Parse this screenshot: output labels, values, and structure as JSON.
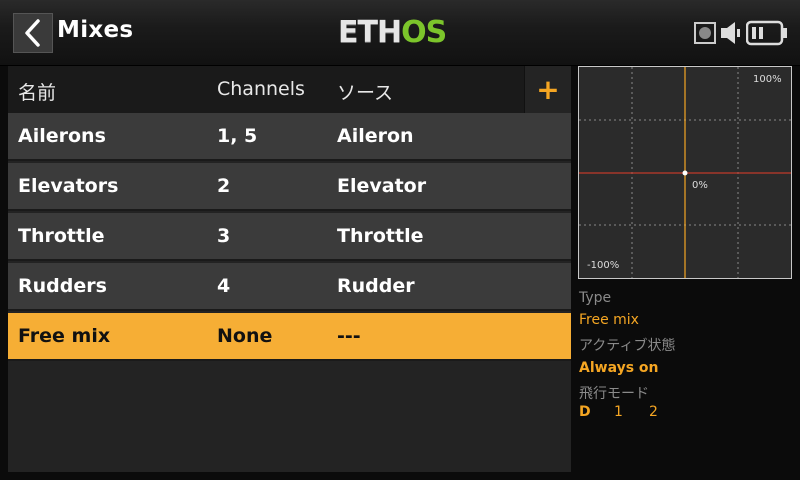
{
  "header": {
    "title": "Mixes",
    "logo": {
      "white": "ETH",
      "green": "OS"
    },
    "icons": [
      "back-chevron-icon",
      "record-icon",
      "speaker-icon",
      "battery-icon"
    ]
  },
  "table": {
    "columns": [
      "名前",
      "Channels",
      "ソース"
    ],
    "add_label": "+",
    "rows": [
      {
        "name": "Ailerons",
        "channels": "1, 5",
        "source": "Aileron"
      },
      {
        "name": "Elevators",
        "channels": "2",
        "source": "Elevator"
      },
      {
        "name": "Throttle",
        "channels": "3",
        "source": "Throttle"
      },
      {
        "name": "Rudders",
        "channels": "4",
        "source": "Rudder"
      },
      {
        "name": "Free mix",
        "channels": "None",
        "source": "---"
      }
    ],
    "selected_index": 4
  },
  "curve": {
    "max_label": "100%",
    "min_label": "-100%",
    "center_label": "0%"
  },
  "details": {
    "type_label": "Type",
    "type_value": "Free mix",
    "active_label": "アクティブ状態",
    "active_value": "Always on",
    "flight_mode_label": "飛行モード",
    "flight_modes": [
      "D",
      "1",
      "2"
    ]
  },
  "colors": {
    "accent": "#f6ae35",
    "logo_green": "#7cc52b",
    "curve_vertical": "#f5a623",
    "curve_horizontal": "#c0392b"
  }
}
